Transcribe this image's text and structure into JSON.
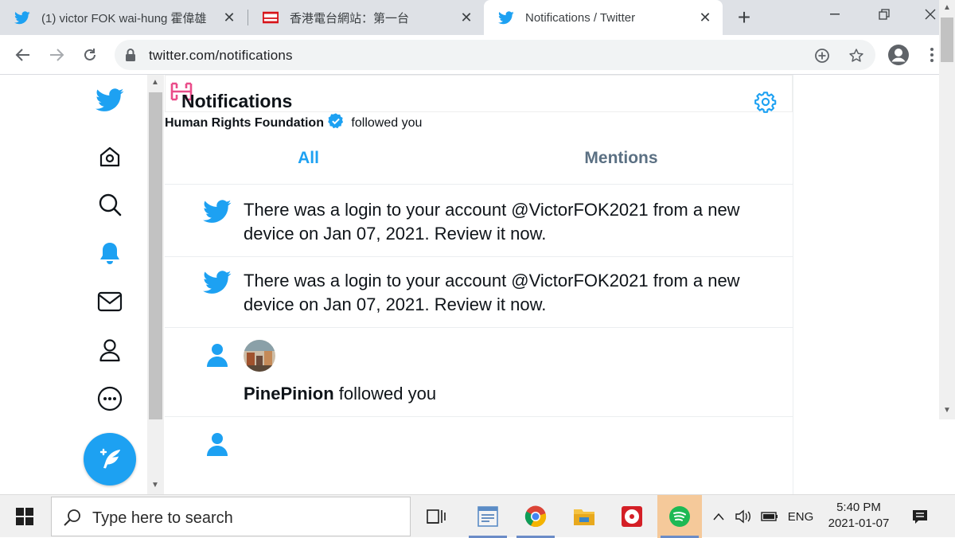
{
  "browser": {
    "tabs": [
      {
        "title": "(1) victor FOK wai-hung 霍偉雄",
        "favicon": "twitter-bird-icon",
        "active": false
      },
      {
        "title": "香港電台網站：第一台",
        "favicon": "rthk-icon",
        "active": false
      },
      {
        "title": "Notifications / Twitter",
        "favicon": "twitter-bird-icon",
        "active": true
      }
    ],
    "new_tab": "+",
    "url": "twitter.com/notifications"
  },
  "twitter": {
    "header_title": "Notifications",
    "tabs": [
      {
        "label": "All",
        "selected": true
      },
      {
        "label": "Mentions",
        "selected": false
      }
    ],
    "notifications": [
      {
        "type": "security",
        "icon": "twitter-bird-icon",
        "text": "There was a login to your account @VictorFOK2021 from a new device on Jan 07, 2021. Review it now."
      },
      {
        "type": "security",
        "icon": "twitter-bird-icon",
        "text": "There was a login to your account @VictorFOK2021 from a new device on Jan 07, 2021. Review it now."
      },
      {
        "type": "follow",
        "icon": "person-icon",
        "name": "PinePinion",
        "suffix": " followed you",
        "verified": false
      },
      {
        "type": "follow",
        "icon": "person-icon",
        "name": "Human Rights Foundation",
        "suffix": " followed you",
        "verified": true
      }
    ],
    "accent_color": "#1da1f2"
  },
  "taskbar": {
    "search_placeholder": "Type here to search",
    "language": "ENG",
    "time": "5:40 PM",
    "date": "2021-01-07"
  }
}
